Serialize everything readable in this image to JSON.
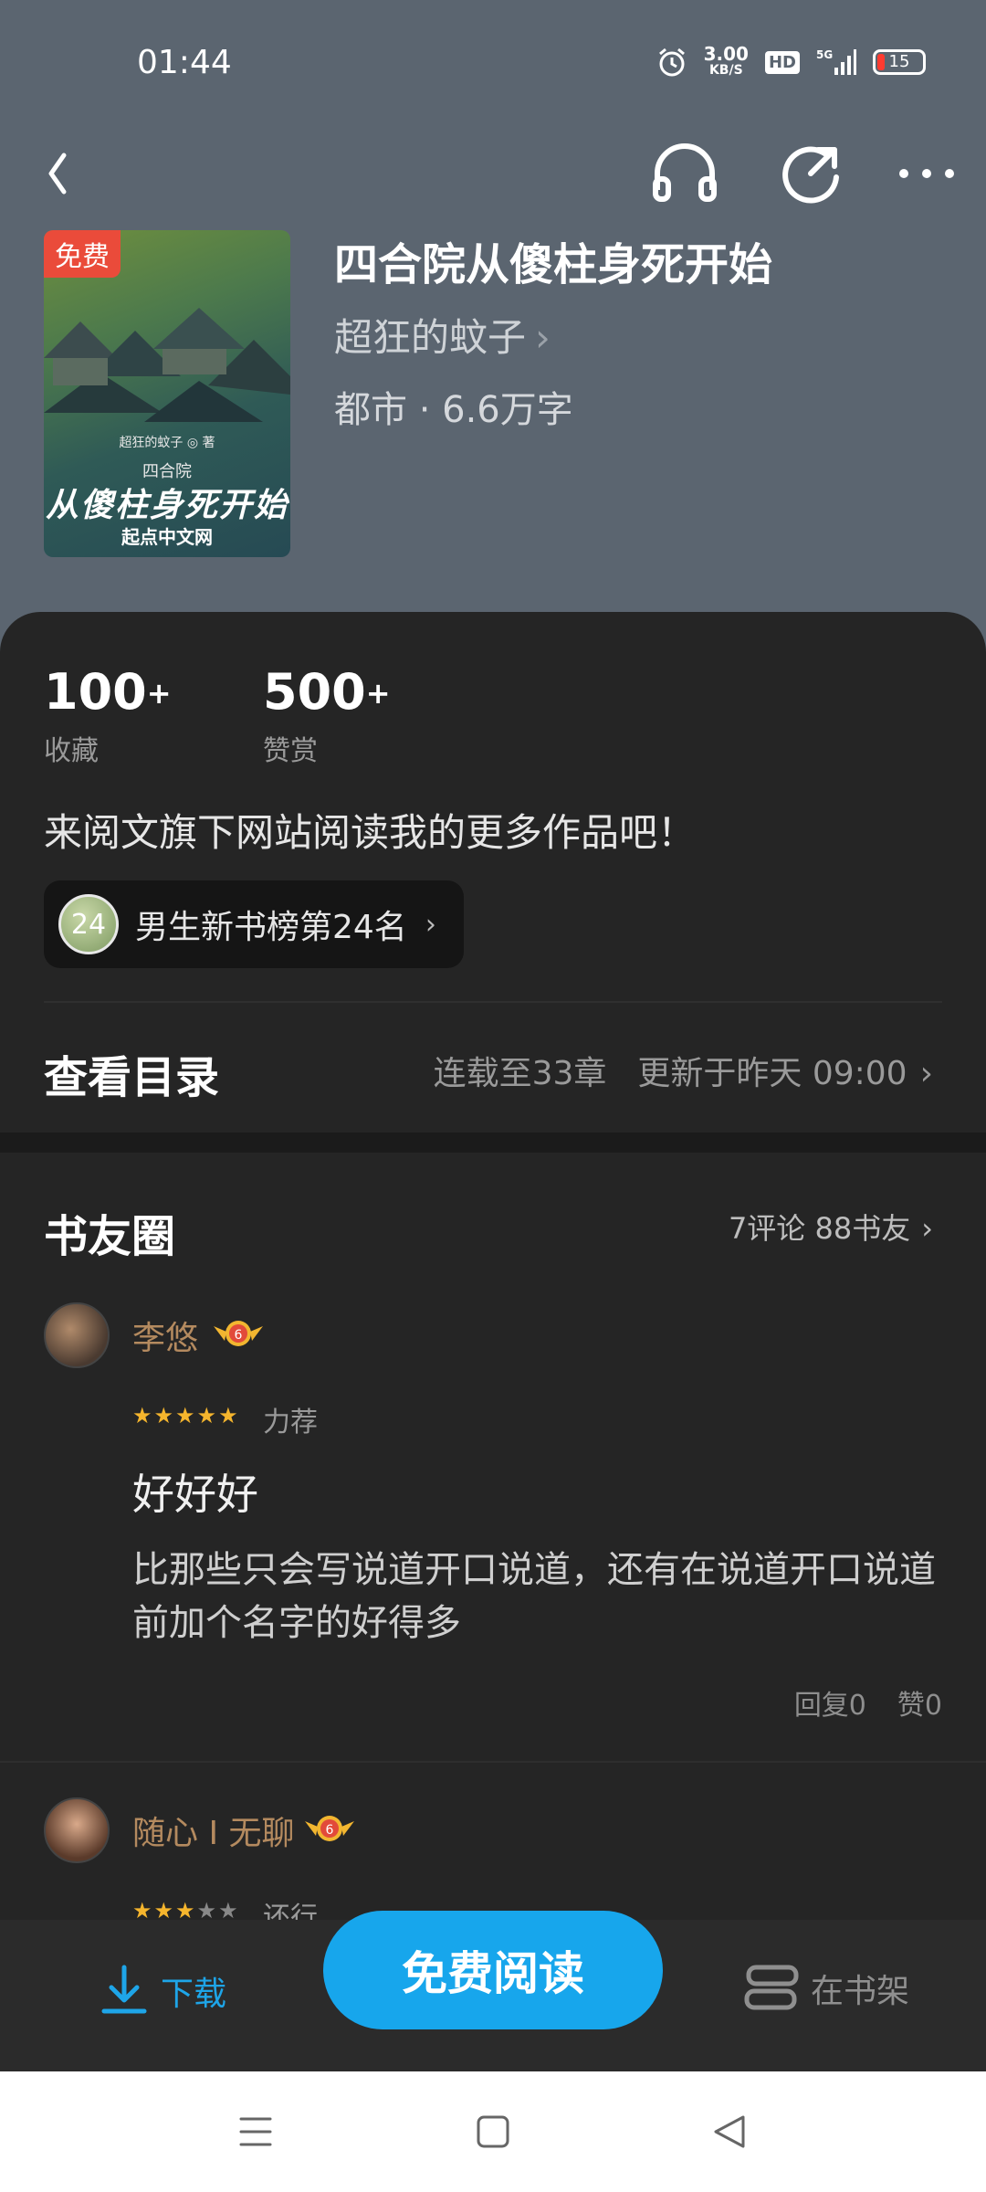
{
  "status": {
    "time": "01:44",
    "speed_value": "3.00",
    "speed_unit": "KB/S",
    "hd": "HD",
    "network": "5G",
    "battery": "15"
  },
  "book": {
    "cover_tag": "免费",
    "cover_author_small": "超狂的蚊子 ◎ 著",
    "cover_subtitle": "四合院",
    "cover_title": "从傻柱身死开始",
    "cover_publisher": "起点中文网",
    "title": "四合院从傻柱身死开始",
    "author": "超狂的蚊子",
    "meta": "都市 · 6.6万字"
  },
  "stats": [
    {
      "value": "100",
      "suffix": "+",
      "label": "收藏"
    },
    {
      "value": "500",
      "suffix": "+",
      "label": "赞赏"
    }
  ],
  "promo": "来阅文旗下网站阅读我的更多作品吧！",
  "rank": {
    "badge": "24",
    "text": "男生新书榜第24名"
  },
  "toc": {
    "title": "查看目录",
    "serial": "连载至33章",
    "updated": "更新于昨天 09:00"
  },
  "circle": {
    "title": "书友圈",
    "info": "7评论 88书友"
  },
  "comments": [
    {
      "user": "李悠",
      "level": "6",
      "stars": 5,
      "rating_text": "力荐",
      "title": "好好好",
      "body": "比那些只会写说道开口说道，还有在说道开口说道前加个名字的好得多",
      "reply": "回复0",
      "like": "赞0"
    },
    {
      "user": "随心 I 无聊",
      "level": "6",
      "stars": 3,
      "rating_text": "还行"
    }
  ],
  "bottom": {
    "download": "下载",
    "read": "免费阅读",
    "shelf": "在书架"
  },
  "colors": {
    "accent": "#17a6ec",
    "header_bg": "#5b6570",
    "panel_bg": "#252525"
  }
}
